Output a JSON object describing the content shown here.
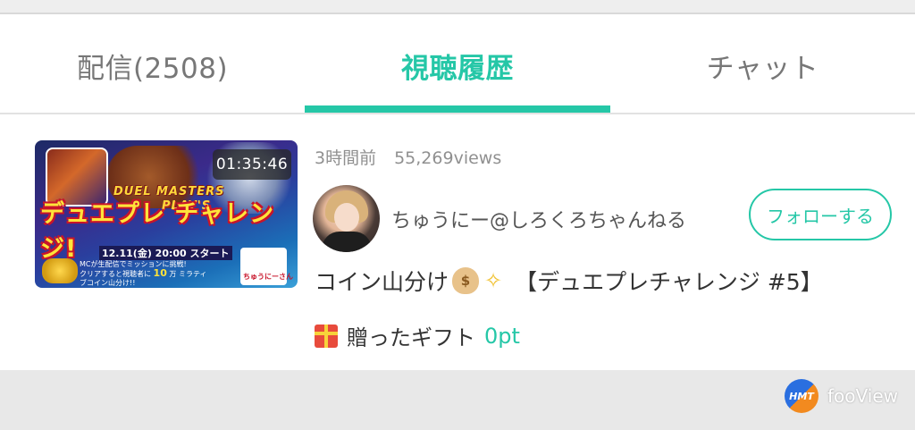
{
  "tabs": [
    {
      "label": "配信(2508)",
      "active": false
    },
    {
      "label": "視聴履歴",
      "active": true
    },
    {
      "label": "チャット",
      "active": false
    }
  ],
  "colors": {
    "accent": "#25c7a7",
    "text": "#333333",
    "muted": "#909090"
  },
  "video": {
    "duration": "01:35:46",
    "posted": "3時間前",
    "views": "55,269views",
    "channel_name": "ちゅうにー@しろくろちゃんねる",
    "follow_label": "フォローする",
    "title_prefix": "コイン山分け",
    "title_suffix": "【デュエプレチャレンジ #5】",
    "title_icons": [
      "money-bag-icon",
      "sparkle-icon"
    ],
    "gift_label": "贈ったギフト",
    "gift_points": "0pt",
    "thumbnail": {
      "logo_line1": "DUEL MASTERS",
      "logo_line2": "PLAY'S",
      "banner": "デュエプレ チャレンジ!",
      "date_text": "12.11(金) 20:00 スタート",
      "note_line1": "MCが生配信でミッションに挑戦!",
      "note_line2": "クリアすると視聴者に",
      "note_amount": "10",
      "note_line3": "万 ミラティブコイン山分け!!",
      "mc_label": "ちゅうにーさん"
    }
  },
  "watermark": {
    "logo": "HMT",
    "text": "fooView"
  }
}
